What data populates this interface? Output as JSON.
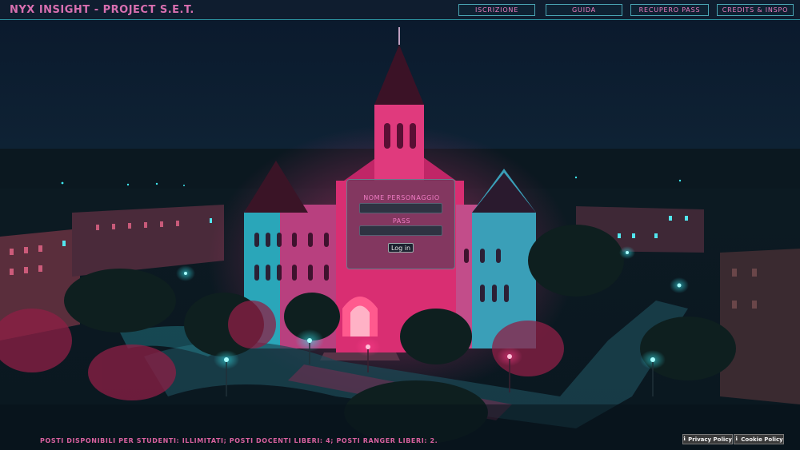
{
  "header": {
    "title": "NYX INSIGHT - PROJECT S.E.T.",
    "nav": [
      "ISCRIZIONE",
      "GUIDA",
      "RECUPERO PASS",
      "CREDITS & INSPO"
    ]
  },
  "login": {
    "character_label": "NOME PERSONAGGIO",
    "character_value": "",
    "pass_label": "PASS",
    "pass_value": "",
    "button_label": "Log in"
  },
  "footer": {
    "availability": "POSTI DISPONIBILI PER STUDENTI: ILLIMITATI; POSTI DOCENTI LIBERI: 4; POSTI RANGER LIBERI: 2.",
    "privacy_label": "Privacy Policy",
    "cookie_label": "Cookie Policy",
    "icons": [
      "info-icon",
      "info-icon"
    ]
  },
  "colors": {
    "accent_pink": "#ef7fc3",
    "accent_teal": "#4aa5b4",
    "header_bg": "#0f1d2f"
  }
}
